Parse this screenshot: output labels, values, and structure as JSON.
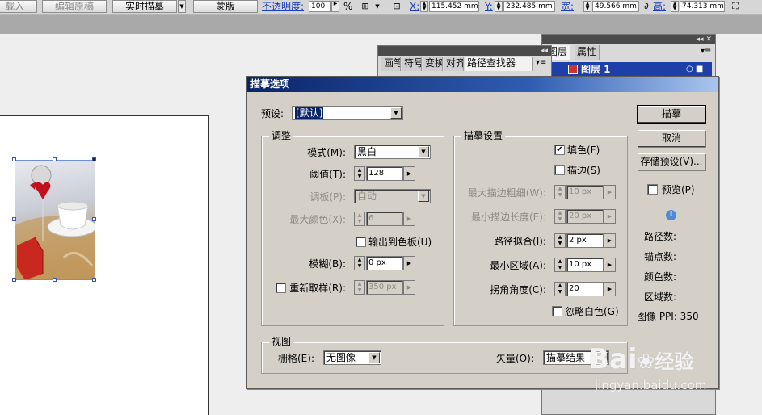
{
  "toolbar": {
    "btn_place": "载入",
    "btn_edit_original": "编辑原稿",
    "btn_live_trace": "实时描摹",
    "btn_mask": "蒙版",
    "opacity_label": "不透明度:",
    "opacity_value": "100",
    "opacity_unit": "%",
    "x_label": "X:",
    "x_value": "115.452 mm",
    "y_label": "Y:",
    "y_value": "232.485 mm",
    "w_label": "宽:",
    "w_value": "49.566 mm",
    "h_label": "高:",
    "h_value": "74.313 mm"
  },
  "panels": {
    "tabs_a": [
      "画笔",
      "符号",
      "变换",
      "对齐",
      "路径查找器"
    ],
    "tabs_b": [
      "图层",
      "属性"
    ],
    "layer_name": "图层 1"
  },
  "dialog": {
    "title": "描摹选项",
    "preset_label": "预设:",
    "preset_value": "[默认]",
    "adjust": {
      "title": "调整",
      "mode_label": "模式(M):",
      "mode_value": "黑白",
      "threshold_label": "阈值(T):",
      "threshold_value": "128",
      "palette_label": "调板(P):",
      "palette_value": "自动",
      "max_colors_label": "最大颜色(X):",
      "max_colors_value": "6",
      "output_swatches_label": "输出到色板(U)",
      "output_swatches_checked": false,
      "blur_label": "模糊(B):",
      "blur_value": "0 px",
      "resample_label": "重新取样(R):",
      "resample_value": "350 px",
      "resample_checked": false
    },
    "trace": {
      "title": "描摹设置",
      "fill_label": "填色(F)",
      "fill_checked": true,
      "stroke_label": "描边(S)",
      "stroke_checked": false,
      "max_stroke_weight_label": "最大描边粗细(W):",
      "max_stroke_weight_value": "10 px",
      "min_stroke_length_label": "最小描边长度(E):",
      "min_stroke_length_value": "20 px",
      "path_fitting_label": "路径拟合(I):",
      "path_fitting_value": "2 px",
      "min_area_label": "最小区域(A):",
      "min_area_value": "10 px",
      "corner_angle_label": "拐角角度(C):",
      "corner_angle_value": "20",
      "ignore_white_label": "忽略白色(G)",
      "ignore_white_checked": false
    },
    "view": {
      "title": "视图",
      "raster_label": "栅格(E):",
      "raster_value": "无图像",
      "vector_label": "矢量(O):",
      "vector_value": "描摹结果"
    },
    "buttons": {
      "trace": "描摹",
      "cancel": "取消",
      "save_preset": "存储预设(V)..."
    },
    "preview_label": "预览(P)",
    "preview_checked": false,
    "stats": {
      "paths": "路径数:",
      "anchors": "锚点数:",
      "colors": "颜色数:",
      "areas": "区域数:",
      "ppi": "图像 PPI: 350"
    }
  },
  "watermark": {
    "brand": "Bai",
    "brand_cn": "经验",
    "url": "jingyan.baidu.com"
  }
}
